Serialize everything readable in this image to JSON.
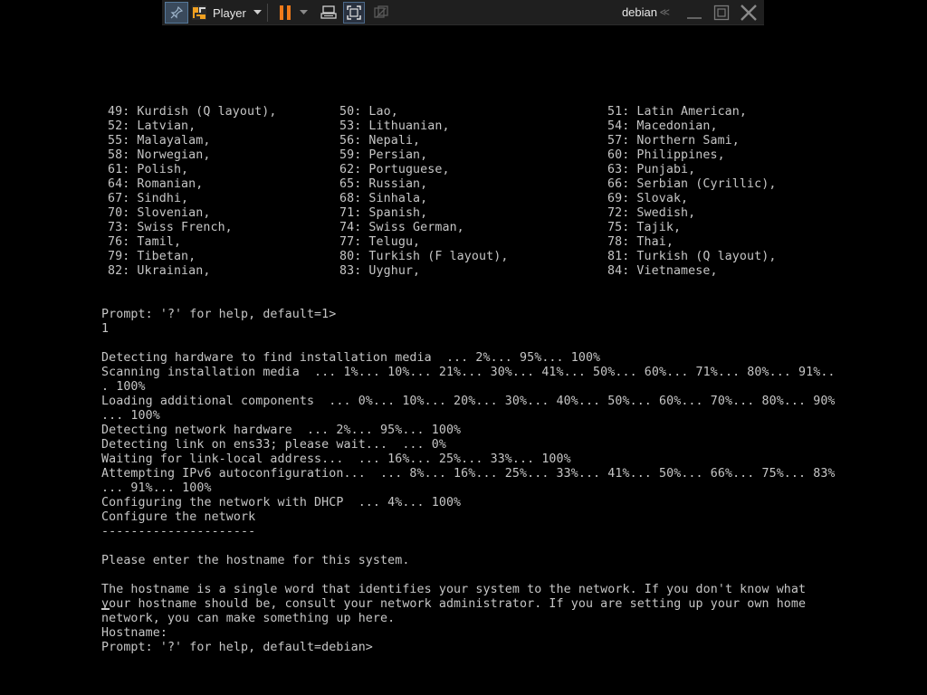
{
  "toolbar": {
    "player_label": "Player",
    "vm_name": "debian",
    "chevron_glyph": "≪",
    "icons": [
      "pin-icon",
      "player-logo-icon",
      "caret-down-icon",
      "pause-icon",
      "send-ctrl-alt-del-icon",
      "fullscreen-icon",
      "unity-icon",
      "minimize-icon",
      "restore-icon",
      "close-icon"
    ],
    "accent_color": "#f07a1a"
  },
  "keymap_rows": [
    [
      "49: Kurdish (Q layout),",
      "50: Lao,",
      "51: Latin American,"
    ],
    [
      "52: Latvian,",
      "53: Lithuanian,",
      "54: Macedonian,"
    ],
    [
      "55: Malayalam,",
      "56: Nepali,",
      "57: Northern Sami,"
    ],
    [
      "58: Norwegian,",
      "59: Persian,",
      "60: Philippines,"
    ],
    [
      "61: Polish,",
      "62: Portuguese,",
      "63: Punjabi,"
    ],
    [
      "64: Romanian,",
      "65: Russian,",
      "66: Serbian (Cyrillic),"
    ],
    [
      "67: Sindhi,",
      "68: Sinhala,",
      "69: Slovak,"
    ],
    [
      "70: Slovenian,",
      "71: Spanish,",
      "72: Swedish,"
    ],
    [
      "73: Swiss French,",
      "74: Swiss German,",
      "75: Tajik,"
    ],
    [
      "76: Tamil,",
      "77: Telugu,",
      "78: Thai,"
    ],
    [
      "79: Tibetan,",
      "80: Turkish (F layout),",
      "81: Turkish (Q layout),"
    ],
    [
      "82: Ukrainian,",
      "83: Uyghur,",
      "84: Vietnamese,"
    ]
  ],
  "lines": [
    "Prompt: '?' for help, default=1>",
    "1",
    "",
    "Detecting hardware to find installation media  ... 2%... 95%... 100%",
    "Scanning installation media  ... 1%... 10%... 21%... 30%... 41%... 50%... 60%... 71%... 80%... 91%..",
    ". 100%",
    "Loading additional components  ... 0%... 10%... 20%... 30%... 40%... 50%... 60%... 70%... 80%... 90%",
    "... 100%",
    "Detecting network hardware  ... 2%... 95%... 100%",
    "Detecting link on ens33; please wait...  ... 0%",
    "Waiting for link-local address...  ... 16%... 25%... 33%... 100%",
    "Attempting IPv6 autoconfiguration...  ... 8%... 16%... 25%... 33%... 41%... 50%... 66%... 75%... 83%",
    "... 91%... 100%",
    "Configuring the network with DHCP  ... 4%... 100%",
    "Configure the network",
    "---------------------",
    "",
    "Please enter the hostname for this system.",
    "",
    "The hostname is a single word that identifies your system to the network. If you don't know what",
    "your hostname should be, consult your network administrator. If you are setting up your own home",
    "network, you can make something up here.",
    "Hostname:",
    "Prompt: '?' for help, default=debian>"
  ]
}
